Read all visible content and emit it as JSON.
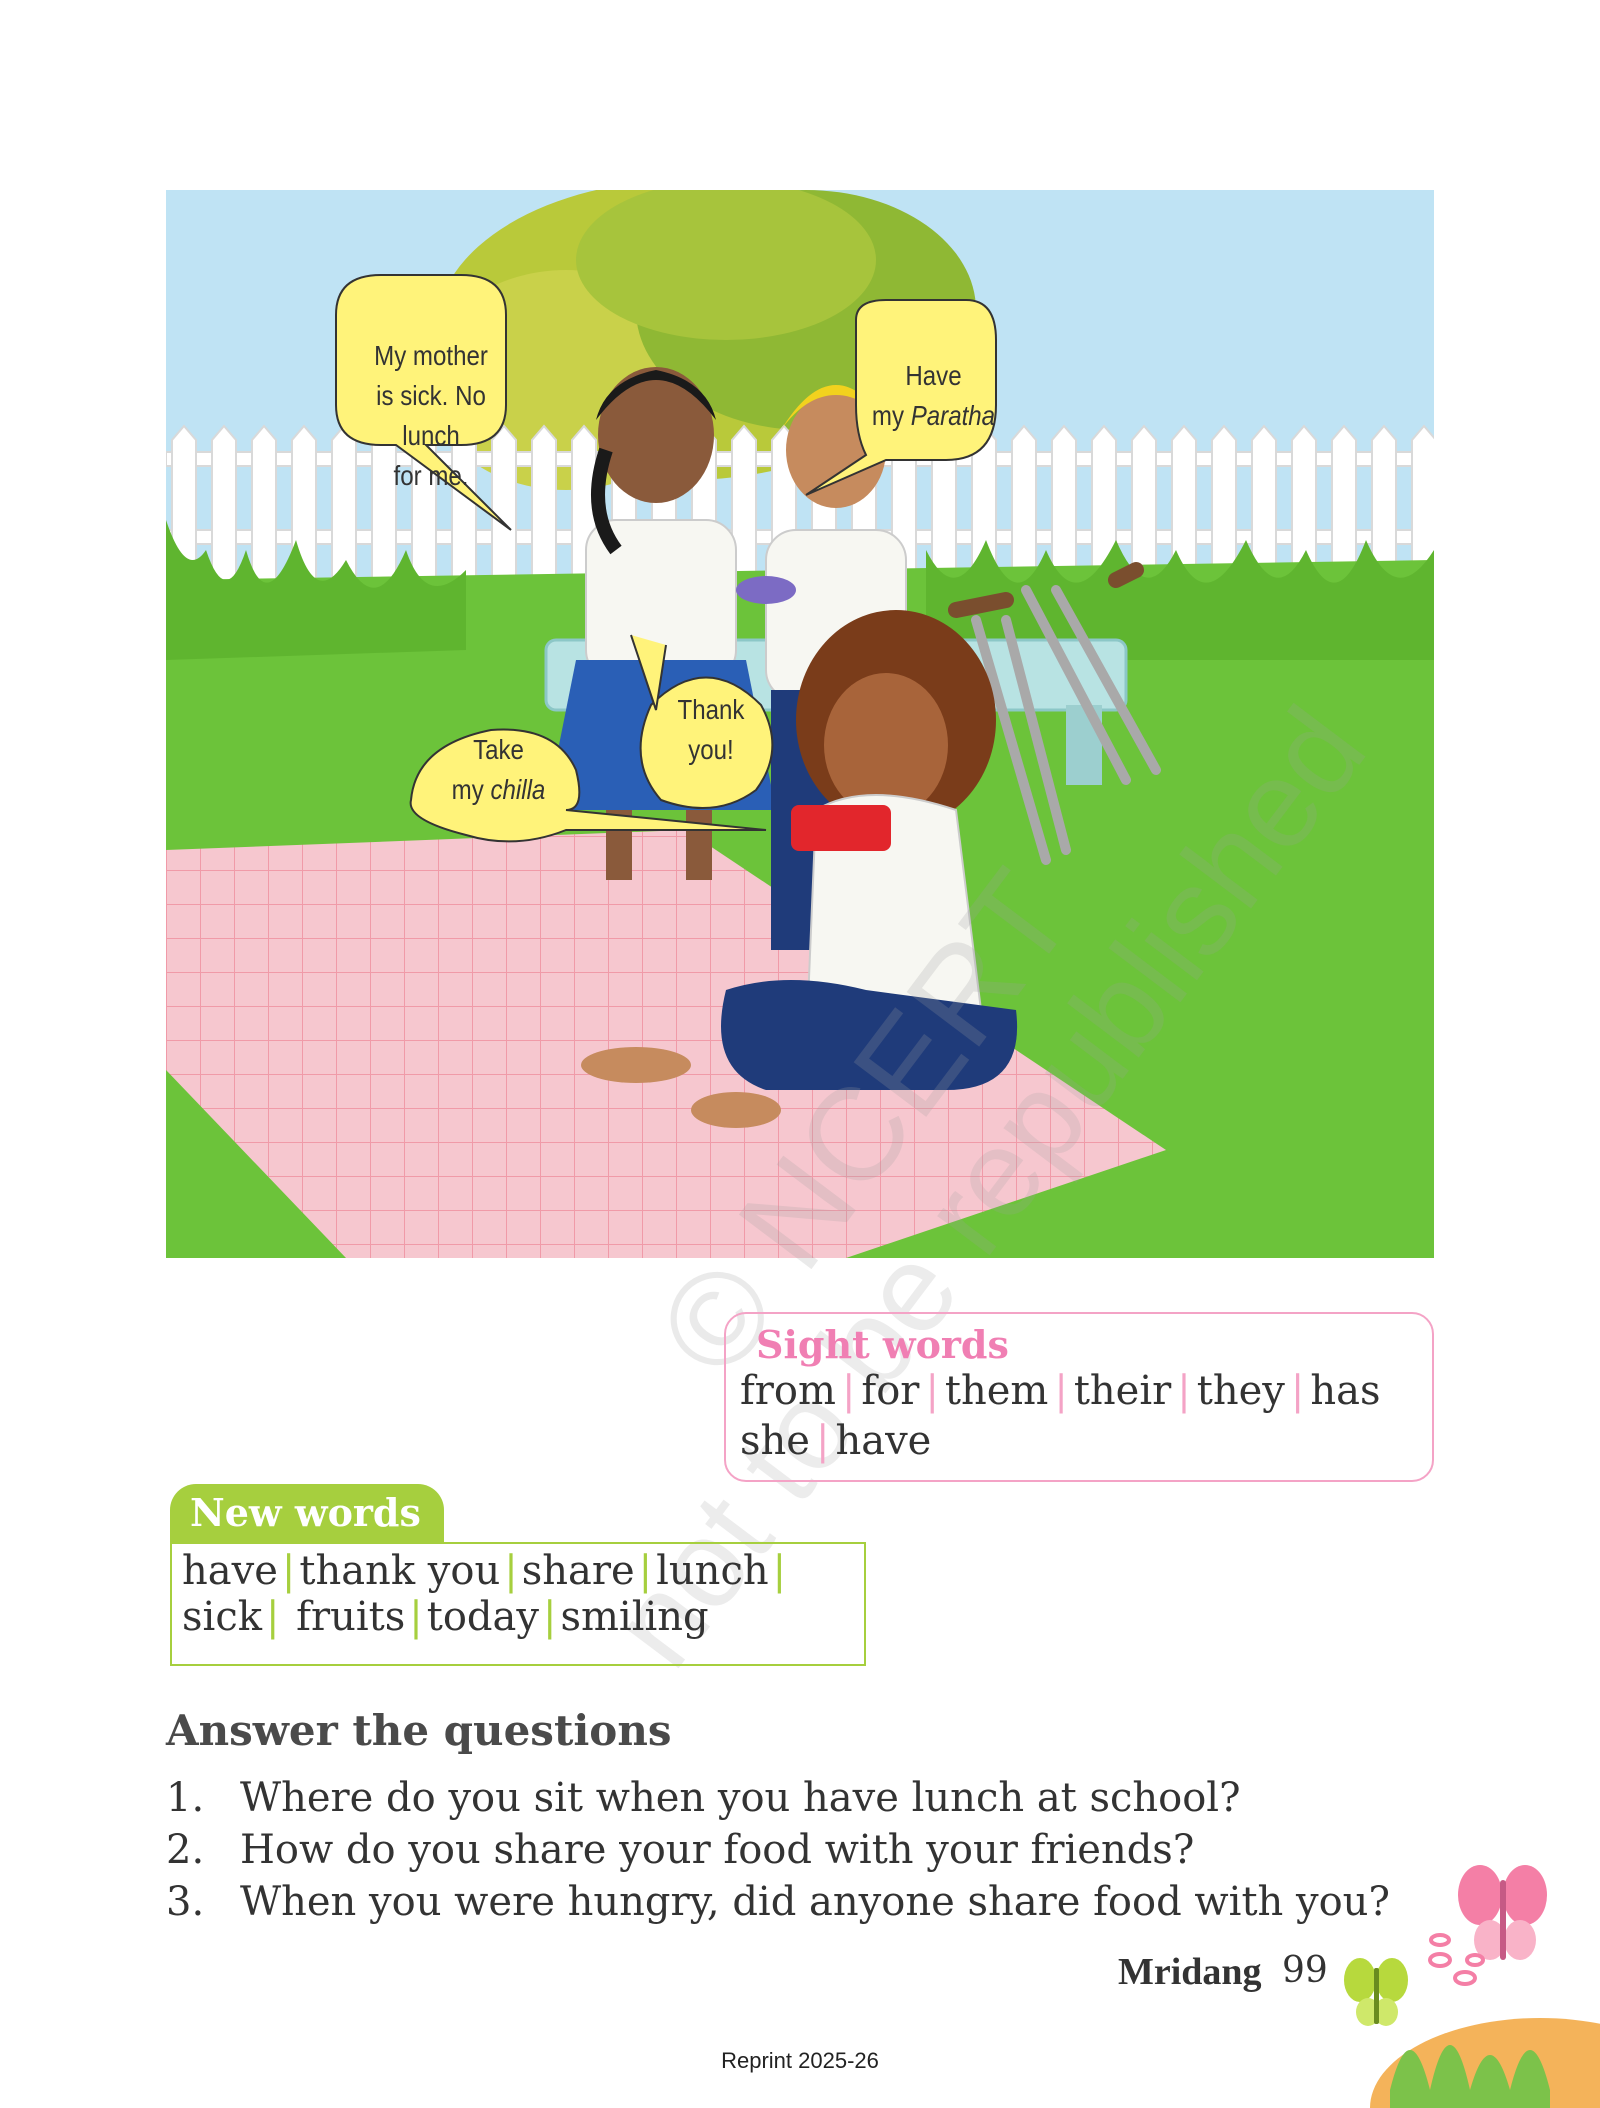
{
  "illustration": {
    "speech_bubbles": [
      {
        "id": "girl",
        "lines": [
          "My mother",
          "is sick. No lunch",
          "for me."
        ]
      },
      {
        "id": "turban-boy",
        "line1": "Have",
        "line2_plain": "my ",
        "line2_italic": "Paratha"
      },
      {
        "id": "girl-thanks",
        "lines": [
          "Thank",
          "you!"
        ]
      },
      {
        "id": "sitting-boy",
        "line1": "Take",
        "line2_plain": "my ",
        "line2_italic": "chilla"
      }
    ]
  },
  "watermark": {
    "line1": "© NCERT",
    "line2": "not to be republished"
  },
  "sight_words": {
    "title": "Sight words",
    "line1": [
      "from",
      "for",
      "them",
      "their",
      "they",
      "has"
    ],
    "line2": [
      "she",
      "have"
    ]
  },
  "new_words": {
    "title": "New words",
    "line1": [
      "have",
      "thank you",
      "share",
      "lunch"
    ],
    "line2": [
      "sick",
      "fruits",
      "today",
      "smiling"
    ]
  },
  "questions": {
    "heading": "Answer the questions",
    "items": [
      {
        "num": "1.",
        "text": "Where do you sit when you have lunch at school?"
      },
      {
        "num": "2.",
        "text": "How do you share your food with your friends?"
      },
      {
        "num": "3.",
        "text": "When you were hungry, did anyone share food with you?"
      }
    ]
  },
  "footer": {
    "book": "Mridang",
    "page": "99",
    "reprint": "Reprint 2025-26"
  }
}
